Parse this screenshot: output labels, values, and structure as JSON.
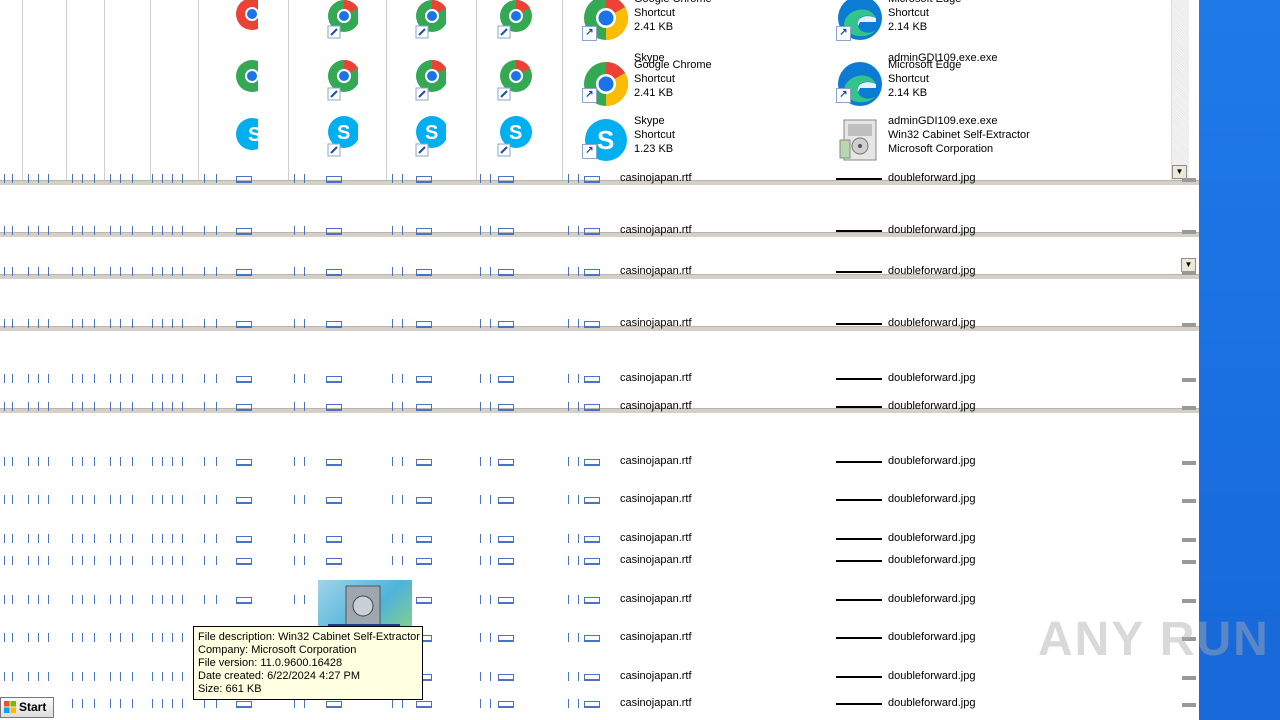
{
  "files": {
    "chrome": {
      "name": "Google Chrome",
      "type": "Shortcut",
      "size": "2.41 KB"
    },
    "edge": {
      "name": "Microsoft Edge",
      "type": "Shortcut",
      "size": "2.14 KB"
    },
    "skype": {
      "name": "Skype",
      "type": "Shortcut",
      "size": "1.23 KB"
    },
    "admin": {
      "name": "adminGDI109.exe.exe",
      "type": "Win32 Cabinet Self-Extractor",
      "publisher": "Microsoft Corporation"
    },
    "casino": {
      "name": "casinojapan.rtf"
    },
    "doubleforward": {
      "name": "doubleforward.jpg"
    }
  },
  "tooltip": {
    "description": "File description: Win32 Cabinet Self-Extractor",
    "company": "Company: Microsoft Corporation",
    "version": "File version: 11.0.9600.16428",
    "created": "Date created: 6/22/2024 4:27 PM",
    "size": "Size: 661 KB"
  },
  "taskbar": {
    "start_label": "Start"
  },
  "watermark": {
    "text": "ANY RUN"
  },
  "colors": {
    "desktop": "#1a6fe0",
    "tooltip_bg": "#ffffe1",
    "icon_accent": "#4a73c4"
  }
}
